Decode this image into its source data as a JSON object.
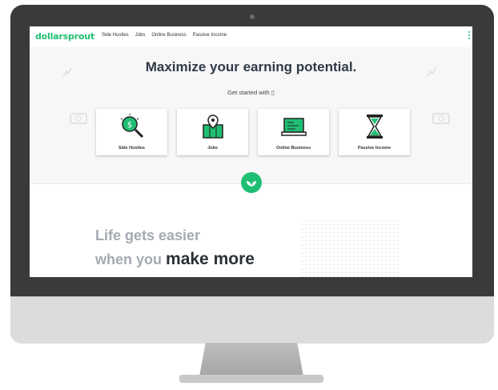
{
  "site": {
    "logo_text": "dollarsprout",
    "nav": [
      "Side Hustles",
      "Jobs",
      "Online Business",
      "Passive Income"
    ]
  },
  "hero": {
    "headline": "Maximize your earning potential.",
    "subline": "Get started with ▯"
  },
  "cards": [
    {
      "label": "Side Hustles",
      "icon": "magnifier-dollar-icon"
    },
    {
      "label": "Jobs",
      "icon": "map-pin-icon"
    },
    {
      "label": "Online Business",
      "icon": "laptop-icon"
    },
    {
      "label": "Passive Income",
      "icon": "hourglass-icon"
    }
  ],
  "tagline": {
    "line1": "Life gets easier",
    "line2_light": "when you",
    "line2_strong": "make more"
  },
  "colors": {
    "brand": "#1fbf73",
    "headline": "#2f3a48",
    "bezel": "#3a3a3a"
  }
}
